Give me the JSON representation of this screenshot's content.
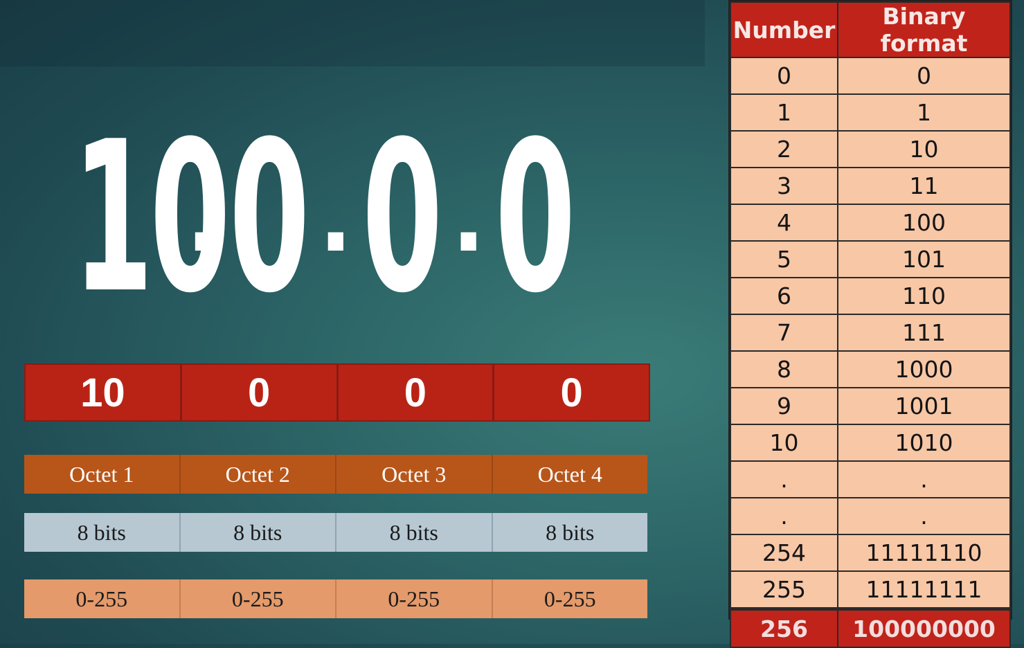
{
  "big_ip": {
    "o1": "10",
    "o2": "0",
    "o3": "0",
    "o4": "0",
    "sep": "."
  },
  "octet_values": [
    "10",
    "0",
    "0",
    "0"
  ],
  "octet_labels": [
    "Octet 1",
    "Octet 2",
    "Octet 3",
    "Octet 4"
  ],
  "bit_labels": [
    "8 bits",
    "8 bits",
    "8 bits",
    "8 bits"
  ],
  "ranges": [
    "0-255",
    "0-255",
    "0-255",
    "0-255"
  ],
  "table": {
    "headers": [
      "Number",
      "Binary format"
    ],
    "rows": [
      [
        "0",
        "0"
      ],
      [
        "1",
        "1"
      ],
      [
        "2",
        "10"
      ],
      [
        "3",
        "11"
      ],
      [
        "4",
        "100"
      ],
      [
        "5",
        "101"
      ],
      [
        "6",
        "110"
      ],
      [
        "7",
        "111"
      ],
      [
        "8",
        "1000"
      ],
      [
        "9",
        "1001"
      ],
      [
        "10",
        "1010"
      ],
      [
        ".",
        "."
      ],
      [
        ".",
        "."
      ],
      [
        "254",
        "11111110"
      ],
      [
        "255",
        "11111111"
      ]
    ],
    "total": [
      "256",
      "100000000"
    ]
  },
  "colors": {
    "red": "#b92316",
    "octet_orange": "#b8561a",
    "bits_blue": "#b7c8d3",
    "range_peach": "#e49a6a",
    "table_cell": "#f7c7a6"
  }
}
